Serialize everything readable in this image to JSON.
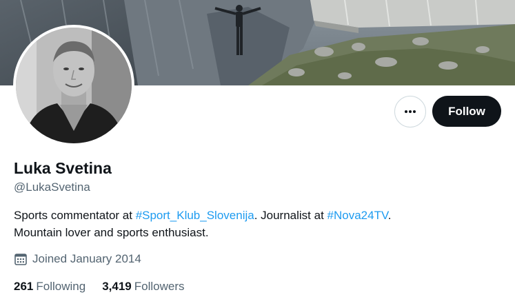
{
  "profile": {
    "name": "Luka Svetina",
    "handle": "@LukaSvetina",
    "bio": {
      "part1": "Sports commentator at ",
      "tag1": "#Sport_Klub_Slovenija",
      "part2": ". Journalist at ",
      "tag2": "#Nova24TV",
      "part3": ".",
      "line2": "Mountain lover and sports enthusiast."
    },
    "joined": "Joined January 2014",
    "following_count": "261",
    "following_label": "Following",
    "followers_count": "3,419",
    "followers_label": "Followers"
  },
  "actions": {
    "follow_label": "Follow",
    "more_icon": "more-horizontal-icon"
  },
  "colors": {
    "accent": "#1d9bf0",
    "follow_bg": "#0f1419",
    "secondary_text": "#536471"
  }
}
